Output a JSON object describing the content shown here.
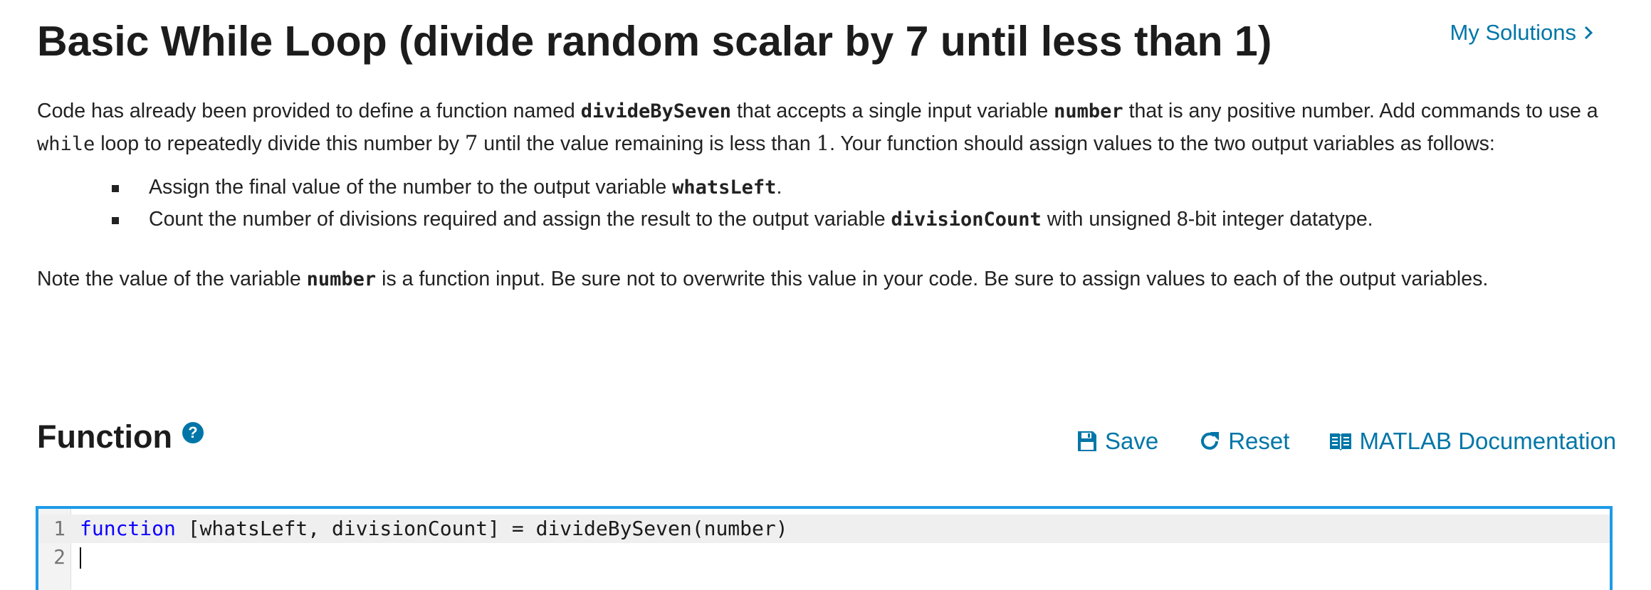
{
  "header": {
    "title": "Basic While Loop (divide random scalar by 7 until less than 1)",
    "my_solutions_label": "My Solutions"
  },
  "description": {
    "p1_part1": "Code has already been provided to define a function named ",
    "p1_func": "divideBySeven",
    "p1_part2": " that accepts a single input variable ",
    "p1_var": "number",
    "p1_part3": " that is any positive number. Add commands to use a ",
    "p1_while": "while",
    "p1_part4": " loop to repeatedly divide this number by ",
    "p1_seven": "7",
    "p1_part5": " until the value remaining is less than ",
    "p1_one": "1",
    "p1_part6": ". Your function should assign values to the two output variables as follows:",
    "bullets": [
      {
        "text": "Assign the final value of the number to the output variable ",
        "code": "whatsLeft",
        "after": "."
      },
      {
        "text": "Count the number of divisions required and assign the result to the output variable ",
        "code": "divisionCount",
        "after": " with unsigned 8-bit integer datatype."
      }
    ],
    "note_part1": "Note the value of the variable ",
    "note_var": "number",
    "note_part2": " is a function input. Be sure not to overwrite this value in your code. Be sure to assign values to each of the output variables."
  },
  "function_section": {
    "title": "Function",
    "help_icon": "question-circle-icon",
    "toolbar": {
      "save_label": "Save",
      "reset_label": "Reset",
      "docs_label": "MATLAB Documentation"
    }
  },
  "editor": {
    "lines": [
      {
        "number": "1",
        "keyword": "function",
        "rest": " [whatsLeft, divisionCount] = divideBySeven(number)"
      },
      {
        "number": "2",
        "keyword": "",
        "rest": ""
      }
    ]
  },
  "colors": {
    "link": "#0076a8",
    "editor_border": "#1d9be8",
    "keyword": "#0e00ff"
  }
}
